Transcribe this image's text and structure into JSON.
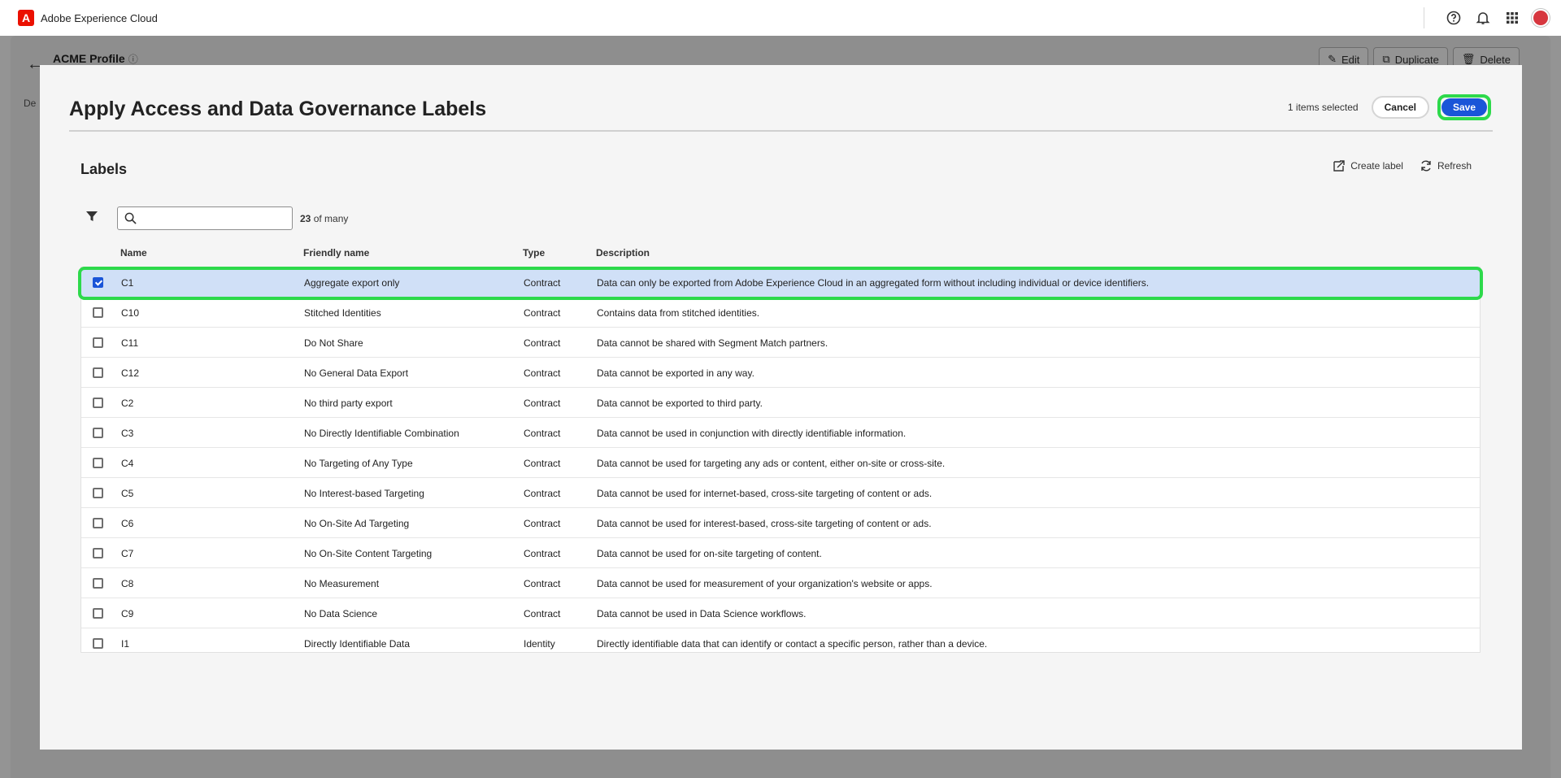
{
  "topbar": {
    "brand": "Adobe Experience Cloud",
    "logo_letter": "A",
    "icons": [
      "help-icon",
      "bell-icon",
      "apps-grid-icon",
      "avatar"
    ]
  },
  "background_page": {
    "title": "ACME Profile",
    "info_icon": "ⓘ",
    "tab_fragment": "De",
    "actions": [
      "Edit",
      "Duplicate",
      "Delete"
    ]
  },
  "modal": {
    "title": "Apply Access and Data Governance Labels",
    "items_selected": "1 items selected",
    "cancel_label": "Cancel",
    "save_label": "Save",
    "section_title": "Labels",
    "create_label": "Create label",
    "refresh_label": "Refresh",
    "search": {
      "value": "",
      "placeholder": ""
    },
    "result_count_num": "23",
    "result_count_suffix": " of many",
    "columns": [
      "Name",
      "Friendly name",
      "Type",
      "Description"
    ],
    "rows": [
      {
        "checked": true,
        "name": "C1",
        "friendly": "Aggregate export only",
        "type": "Contract",
        "desc": "Data can only be exported from Adobe Experience Cloud in an aggregated form without including individual or device identifiers."
      },
      {
        "checked": false,
        "name": "C10",
        "friendly": "Stitched Identities",
        "type": "Contract",
        "desc": "Contains data from stitched identities."
      },
      {
        "checked": false,
        "name": "C11",
        "friendly": "Do Not Share",
        "type": "Contract",
        "desc": "Data cannot be shared with Segment Match partners."
      },
      {
        "checked": false,
        "name": "C12",
        "friendly": "No General Data Export",
        "type": "Contract",
        "desc": "Data cannot be exported in any way."
      },
      {
        "checked": false,
        "name": "C2",
        "friendly": "No third party export",
        "type": "Contract",
        "desc": "Data cannot be exported to third party."
      },
      {
        "checked": false,
        "name": "C3",
        "friendly": "No Directly Identifiable Combination",
        "type": "Contract",
        "desc": "Data cannot be used in conjunction with directly identifiable information."
      },
      {
        "checked": false,
        "name": "C4",
        "friendly": "No Targeting of Any Type",
        "type": "Contract",
        "desc": "Data cannot be used for targeting any ads or content, either on-site or cross-site."
      },
      {
        "checked": false,
        "name": "C5",
        "friendly": "No Interest-based Targeting",
        "type": "Contract",
        "desc": "Data cannot be used for internet-based, cross-site targeting of content or ads."
      },
      {
        "checked": false,
        "name": "C6",
        "friendly": "No On-Site Ad Targeting",
        "type": "Contract",
        "desc": "Data cannot be used for interest-based, cross-site targeting of content or ads."
      },
      {
        "checked": false,
        "name": "C7",
        "friendly": "No On-Site Content Targeting",
        "type": "Contract",
        "desc": "Data cannot be used for on-site targeting of content."
      },
      {
        "checked": false,
        "name": "C8",
        "friendly": "No Measurement",
        "type": "Contract",
        "desc": "Data cannot be used for measurement of your organization's website or apps."
      },
      {
        "checked": false,
        "name": "C9",
        "friendly": "No Data Science",
        "type": "Contract",
        "desc": "Data cannot be used in Data Science workflows."
      },
      {
        "checked": false,
        "name": "I1",
        "friendly": "Directly Identifiable Data",
        "type": "Identity",
        "desc": "Directly identifiable data that can identify or contact a specific person, rather than a device."
      }
    ]
  },
  "colors": {
    "accent": "#1a55d8",
    "highlight": "#2dd94b",
    "selected_row": "#d0e0f7",
    "brand_red": "#eb1000"
  }
}
